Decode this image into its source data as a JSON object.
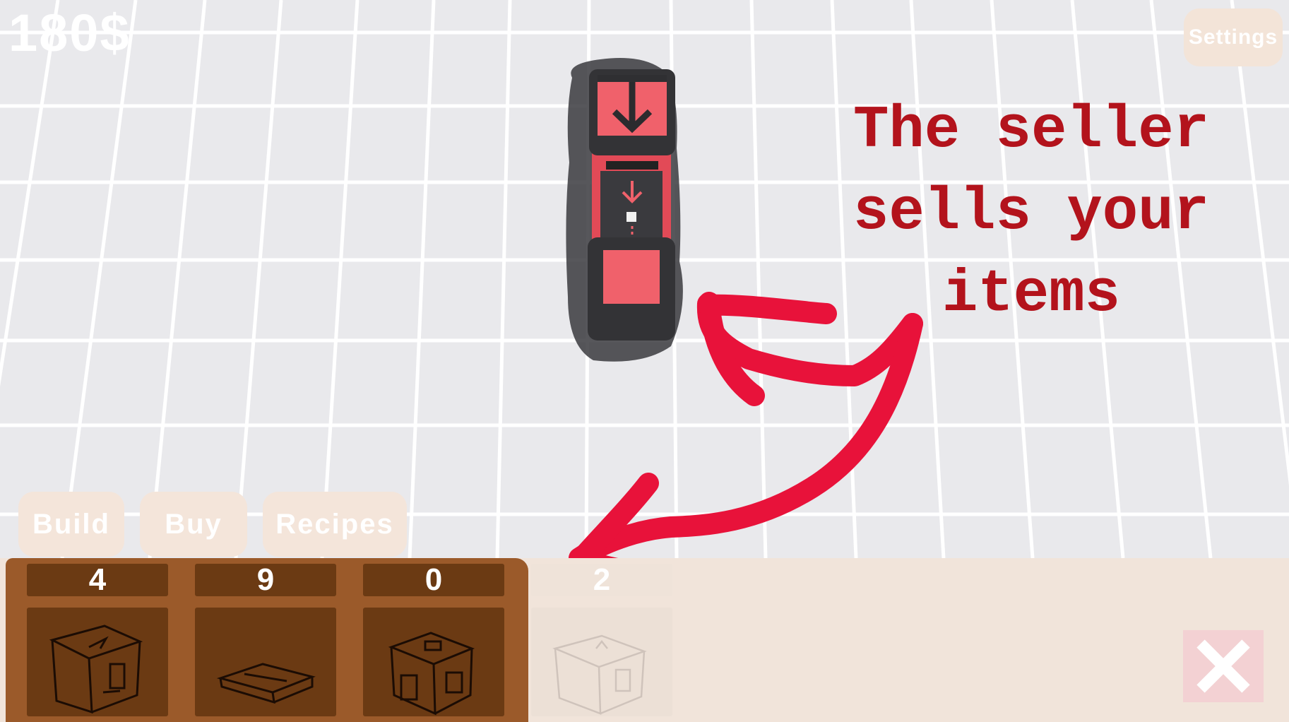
{
  "hud": {
    "money": "180$",
    "settings_label": "Settings"
  },
  "annotation": {
    "lines": [
      "The seller",
      "sells your",
      "items"
    ]
  },
  "tabs": [
    {
      "label": "Build"
    },
    {
      "label": "Buy"
    },
    {
      "label": "Recipes"
    }
  ],
  "inventory": {
    "slots": [
      {
        "count": "4",
        "icon": "seller-box-icon"
      },
      {
        "count": "9",
        "icon": "conveyor-belt-icon"
      },
      {
        "count": "0",
        "icon": "crafter-box-icon"
      },
      {
        "count": "2",
        "icon": "spawner-box-icon"
      }
    ]
  },
  "colors": {
    "accent_red": "#e8123a",
    "machine_red": "#f0616b",
    "panel_brown": "#9b5a2a",
    "slot_brown": "#6b3a13"
  }
}
